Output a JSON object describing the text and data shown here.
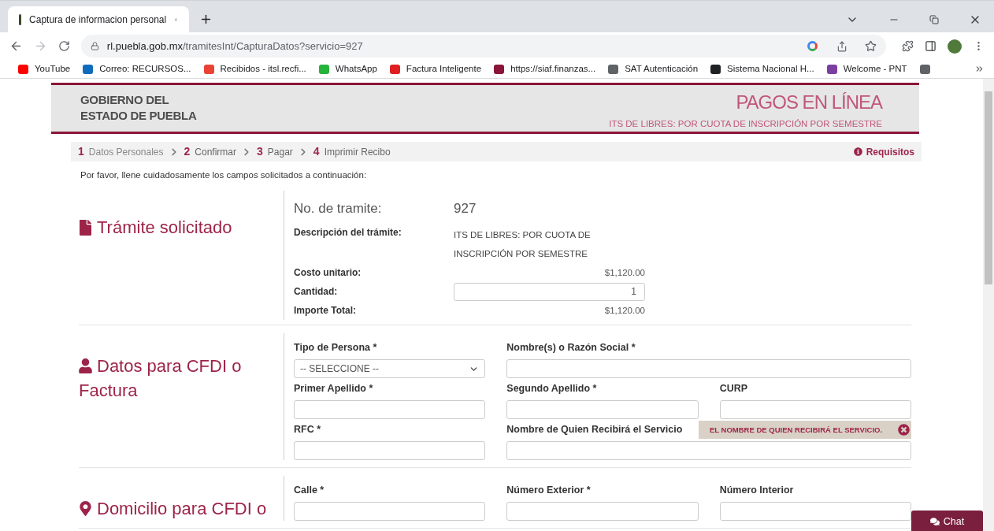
{
  "browser": {
    "tab_title": "Captura de informacion personal",
    "url_host": "rl.puebla.gob.mx",
    "url_path": "/tramitesInt/CapturaDatos?servicio=927",
    "bookmarks": [
      {
        "label": "YouTube",
        "color": "#ff0000"
      },
      {
        "label": "Correo: RECURSOS...",
        "color": "#0f6cbd"
      },
      {
        "label": "Recibidos - itsl.recfi...",
        "color": "#ea4335"
      },
      {
        "label": "WhatsApp",
        "color": "#25b33a"
      },
      {
        "label": "Factura Inteligente",
        "color": "#e02020"
      },
      {
        "label": "https://siaf.finanzas...",
        "color": "#8a1538"
      },
      {
        "label": "SAT Autenticación",
        "color": "#5f6368"
      },
      {
        "label": "Sistema Nacional H...",
        "color": "#202124"
      },
      {
        "label": "Welcome - PNT",
        "color": "#7b3fa0"
      },
      {
        "color": "#5f6368"
      }
    ]
  },
  "header": {
    "org_lines": [
      "GOBIERNO DEL",
      "ESTADO DE PUEBLA"
    ],
    "title": "PAGOS EN LÍNEA",
    "subtitle": "ITS DE LIBRES: POR CUOTA DE INSCRIPCIÓN POR SEMESTRE"
  },
  "steps": [
    {
      "number": "1",
      "label": "Datos Personales"
    },
    {
      "number": "2",
      "label": "Confirmar"
    },
    {
      "number": "3",
      "label": "Pagar"
    },
    {
      "number": "4",
      "label": "Imprimir Recibo"
    }
  ],
  "requisitos": "Requisitos",
  "instructions": "Por favor, llene cuidadosamente los campos solicitados a continuación:",
  "tramite": {
    "title": "Trámite solicitado",
    "rows": [
      {
        "kind": "heading",
        "label": "No. de tramite:",
        "value": "927"
      },
      {
        "kind": "text",
        "label": "Descripción del trámite:",
        "value": "ITS DE LIBRES: POR CUOTA DE INSCRIPCIÓN POR SEMESTRE"
      },
      {
        "kind": "money",
        "label": "Costo unitario:",
        "value": "$1,120.00"
      },
      {
        "kind": "input",
        "label": "Cantidad:",
        "value": "1"
      },
      {
        "kind": "money",
        "label": "Importe Total:",
        "value": "$1,120.00"
      }
    ]
  },
  "form_sections": [
    {
      "title": "Datos para CFDI o Factura",
      "rows": [
        [
          {
            "label": "Tipo de Persona *",
            "kind": "select",
            "value": "-- SELECCIONE --"
          },
          {
            "label": "Nombre(s) o Razón Social *",
            "kind": "text"
          }
        ],
        [
          {
            "label": "Primer Apellido *",
            "kind": "text"
          },
          {
            "label": "Segundo Apellido *",
            "kind": "text"
          },
          {
            "label": "CURP",
            "kind": "text"
          }
        ],
        [
          {
            "label": "RFC *",
            "kind": "text"
          },
          {
            "label": "Nombre de Quien Recibirá el Servicio",
            "kind": "text",
            "error": "EL NOMBRE DE QUIEN RECIBIRÁ EL SERVICIO."
          }
        ]
      ]
    },
    {
      "title": "Domicilio para CFDI o",
      "rows": [
        [
          {
            "label": "Calle *",
            "kind": "text"
          },
          {
            "label": "Número Exterior *",
            "kind": "text"
          },
          {
            "label": "Número Interior",
            "kind": "text"
          }
        ]
      ]
    }
  ],
  "chat": "Chat"
}
